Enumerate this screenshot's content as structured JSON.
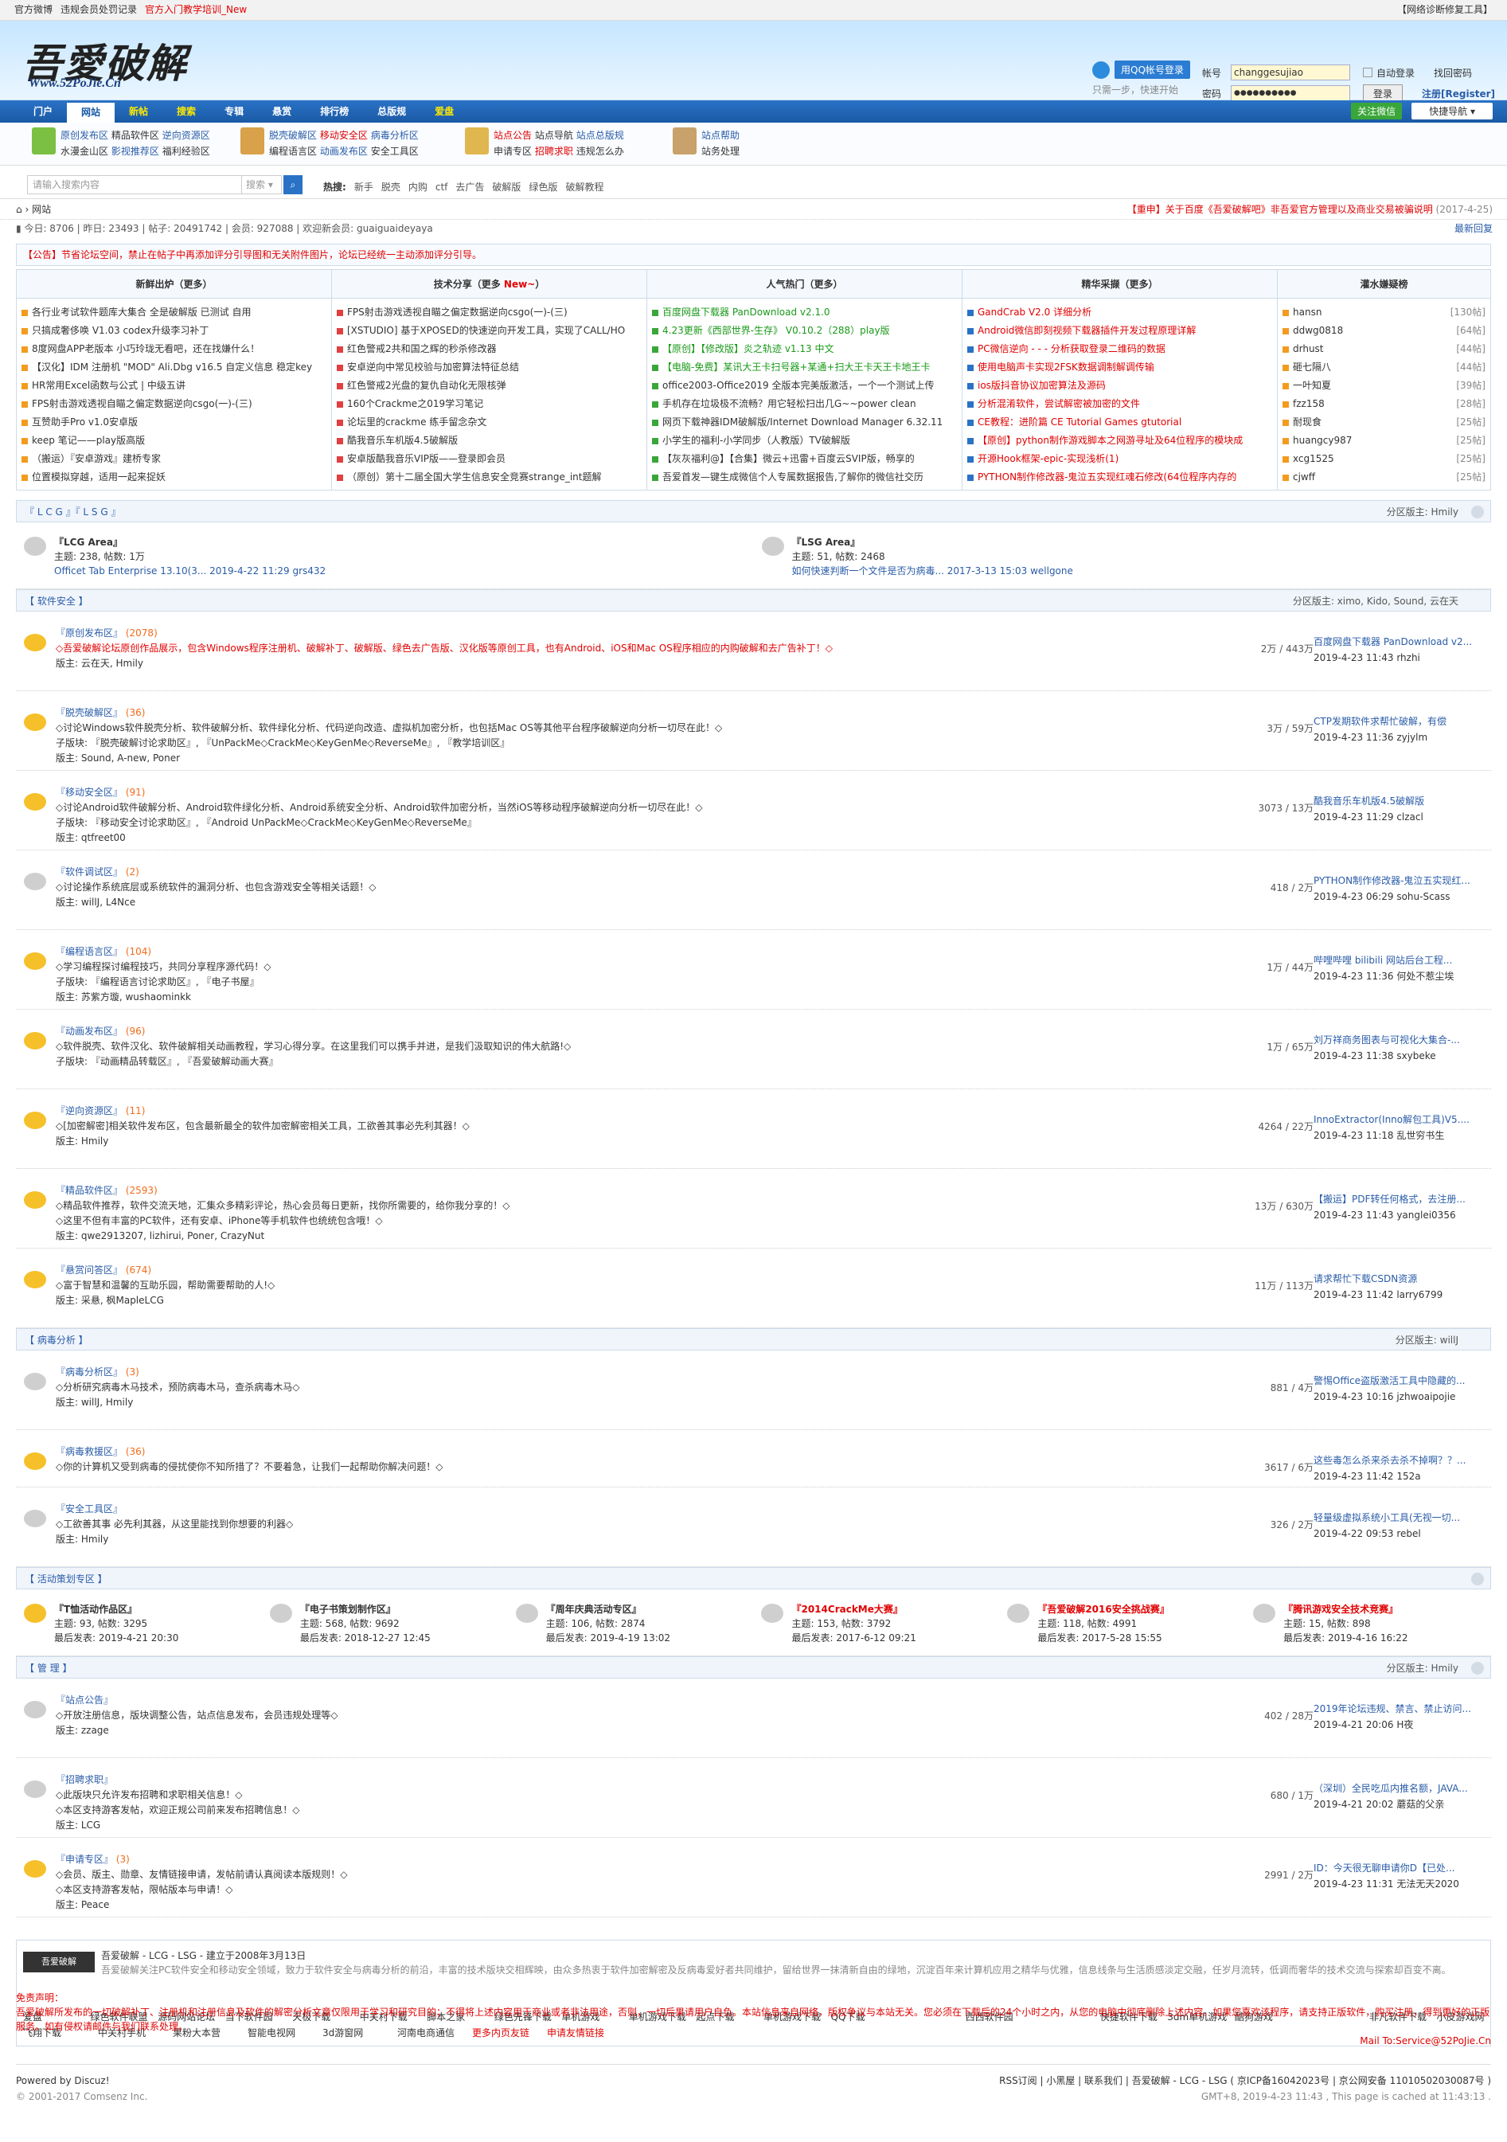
{
  "topbar": {
    "left": [
      "官方微博",
      "违规会员处罚记录",
      "官方入门教学培训_New"
    ],
    "right": "【网络诊断修复工具】"
  },
  "logo": {
    "cn": "吾愛破解",
    "en": "Www.52PoJie.Cn"
  },
  "qq": {
    "login": "用QQ帐号登录",
    "sub": "只需一步，快速开始"
  },
  "login": {
    "account_label": "帐号",
    "account_value": "changgesujiao",
    "auto": "自动登录",
    "find": "找回密码",
    "pwd_label": "密码",
    "pwd_value": "●●●●●●●●●●",
    "btn": "登录",
    "register": "注册[Register]"
  },
  "nav": {
    "items": [
      "门户",
      "网站",
      "新帖",
      "搜索",
      "专辑",
      "悬赏",
      "排行榜",
      "总版规",
      "爱盘"
    ],
    "active": 1,
    "wechat": "关注微信",
    "quick": "快捷导航"
  },
  "subnav": {
    "g1": [
      [
        "原创发布区",
        "精品软件区",
        "逆向资源区"
      ],
      [
        "水漫金山区",
        "影视推荐区",
        "福利经验区"
      ]
    ],
    "g2": [
      [
        "脱壳破解区",
        "移动安全区",
        "病毒分析区"
      ],
      [
        "编程语言区",
        "动画发布区",
        "安全工具区"
      ]
    ],
    "g3": [
      [
        "站点公告",
        "站点导航",
        "站点总版规"
      ],
      [
        "申请专区",
        "招聘求职",
        "违规怎么办"
      ]
    ],
    "g4": [
      [
        "站点帮助"
      ],
      [
        "站务处理"
      ]
    ]
  },
  "search": {
    "placeholder": "请输入搜索内容",
    "select": "搜索",
    "hot_label": "热搜:",
    "hot": [
      "新手",
      "脱壳",
      "内购",
      "ctf",
      "去广告",
      "破解版",
      "绿色版",
      "破解教程"
    ]
  },
  "crumb": {
    "home": "网站",
    "announce": "【重申】关于百度《吾爱破解吧》非吾爱官方管理以及商业交易被骗说明",
    "announce_date": "(2017-4-25)"
  },
  "stats": {
    "text": "今日: 8706 | 昨日: 23493 | 帖子: 20491742 | 会员: 927088 | 欢迎新会员: guaiguaideyaya",
    "latest": "最新回复"
  },
  "notice": "【公告】节省论坛空间，禁止在帖子中再添加评分引导图和无关附件图片，论坛已经统一主动添加评分引导。",
  "top5": [
    {
      "h": "新鲜出炉（更多）",
      "items": [
        "各行业考试软件题库大集合 全是破解版 已测试 自用",
        "只搞成奢侈唤 V1.03 codex升级李习补丁",
        "8度网盘APP老版本 小巧玲珑无看吧，还在找嫌什么！",
        "【汉化】IDM 注册机 \"MOD\" Ali.Dbg v16.5 自定义信息 稳定key",
        "HR常用Excel函数与公式 | 中级五讲",
        "FPS射击游戏透视自瞄之偏定数据逆向csgo(一)-(三)",
        "互赞助手Pro v1.0安卓版",
        "keep 笔记——play版高版",
        "（搬运）『安卓游戏』建桥专家",
        "位置模拟穿越，适用一起来捉妖"
      ]
    },
    {
      "h": "技术分享（更多 New~）",
      "items": [
        "FPS射击游戏透视自瞄之偏定数据逆向csgo(一)-(三)",
        "[XSTUDIO] 基于XPOSED的快速逆向开发工具，实现了CALL/HO",
        "红色警戒2共和国之辉的秒杀修改器",
        "安卓逆向中常见校验与加密算法特征总结",
        "红色警戒2光盘的复仇自动化无限核弹",
        "160个Crackme之019学习笔记",
        "论坛里的crackme 练手留念杂文",
        "酷我音乐车机版4.5破解版",
        "安卓版酷我音乐VIP版——登录即会员",
        "（原创）第十二届全国大学生信息安全竞赛strange_int题解"
      ]
    },
    {
      "h": "人气热门（更多）",
      "items": [
        "百度网盘下载器 PanDownload v2.1.0",
        "4.23更新《西部世界-生存》 V0.10.2（288）play版",
        "【原创】【修改版】炎之轨迹 v1.13 中文",
        "【电脑-免费】某讯大王卡扫号器+某通+扫大王卡天王卡地王卡",
        "office2003-Office2019 全版本完美版激活，一个一个测试上传",
        "手机存在垃圾极不流畅？用它轻松扫出几G~~power clean",
        "网页下载神器IDM破解版/Internet Download Manager 6.32.11",
        "小学生的福利-小学同步（人教版）TV破解版",
        "【灰灰福利@】【合集】微云+迅雷+百度云SVIP版，畅享的",
        "吾爱首发—键生成微信个人专属数据报告,了解你的微信社交历"
      ]
    },
    {
      "h": "精华采撷（更多）",
      "items": [
        "GandCrab V2.0 详细分析",
        "Android微信即刻视频下载器插件开发过程原理详解",
        "PC微信逆向 - - - 分析获取登录二维码的数据",
        "使用电脑声卡实现2FSK数据调制解调传输",
        "ios版抖音协议加密算法及源码",
        "分析混淆软件，尝试解密被加密的文件",
        "CE教程：进阶篇 CE Tutorial Games gtutorial",
        "【原创】python制作游戏脚本之网游寻址及64位程序的模块成",
        "开源Hook框架-epic-实现浅析(1)",
        "PYTHON制作修改器-鬼泣五实现红魂石修改(64位程序内存的"
      ]
    },
    {
      "h": "灌水嫌疑榜",
      "items": [
        [
          "hansn",
          "[130帖]"
        ],
        [
          "ddwg0818",
          "[64帖]"
        ],
        [
          "drhust",
          "[44帖]"
        ],
        [
          "砸七隔八",
          "[44帖]"
        ],
        [
          "一叶知夏",
          "[39帖]"
        ],
        [
          "fzz158",
          "[28帖]"
        ],
        [
          "耐现食",
          "[25帖]"
        ],
        [
          "huangcy987",
          "[25帖]"
        ],
        [
          "xcg1525",
          "[25帖]"
        ],
        [
          "cjwff",
          "[25帖]"
        ]
      ]
    }
  ],
  "lcg": {
    "h": "『 L C G 』『 L S G 』",
    "mod": "分区版主: Hmily",
    "items": [
      {
        "name": "『LCG Area』",
        "stat": "主题: 238, 帖数: 1万",
        "last": "Officet Tab Enterprise 13.10(3... 2019-4-22 11:29 grs432"
      },
      {
        "name": "『LSG Area』",
        "stat": "主题: 51, 帖数: 2468",
        "last": "如何快速判断一个文件是否为病毒... 2017-3-13 15:03 wellgone"
      }
    ]
  },
  "soft": {
    "h": "【 软件安全 】",
    "mod": "分区版主: ximo, Kido, Sound, 云在天",
    "forums": [
      {
        "name": "『原创发布区』",
        "n": "(2078)",
        "desc": "◇吾爱破解论坛原创作品展示，包含Windows程序注册机、破解补丁、破解版、绿色去广告版、汉化版等原创工具，也有Android、iOS和Mac OS程序相应的内购破解和去广告补丁！◇",
        "sub": "",
        "mods": "版主: 云在天, Hmily",
        "cnt": "2万 / 443万",
        "last1": "百度网盘下载器 PanDownload v2...",
        "last2": "2019-4-23 11:43 rhzhi",
        "hl": 1
      },
      {
        "name": "『脱壳破解区』",
        "n": "(36)",
        "desc": "◇讨论Windows软件脱壳分析、软件破解分析、软件绿化分析、代码逆向改造、虚拟机加密分析，也包括Mac OS等其他平台程序破解逆向分析一切尽在此！◇",
        "sub": "子版块: 『脱壳破解讨论求助区』, 『UnPackMe◇CrackMe◇KeyGenMe◇ReverseMe』, 『教学培训区』",
        "mods": "版主: Sound, A-new, Poner",
        "cnt": "3万 / 59万",
        "last1": "CTP发期软件求帮忙破解，有偿",
        "last2": "2019-4-23 11:36 zyjylm",
        "hl": 1
      },
      {
        "name": "『移动安全区』",
        "n": "(91)",
        "desc": "◇讨论Android软件破解分析、Android软件绿化分析、Android系统安全分析、Android软件加密分析，当然iOS等移动程序破解逆向分析一切尽在此！◇",
        "sub": "子版块: 『移动安全讨论求助区』, 『Android UnPackMe◇CrackMe◇KeyGenMe◇ReverseMe』",
        "mods": "版主: qtfreet00",
        "cnt": "3073 / 13万",
        "last1": "酷我音乐车机版4.5破解版",
        "last2": "2019-4-23 11:29 clzacl",
        "hl": 1
      },
      {
        "name": "『软件调试区』",
        "n": "(2)",
        "desc": "◇讨论操作系统底层或系统软件的漏洞分析、也包含游戏安全等相关话题！◇",
        "sub": "",
        "mods": "版主: willJ, L4Nce",
        "cnt": "418 / 2万",
        "last1": "PYTHON制作修改器-鬼泣五实现红...",
        "last2": "2019-4-23 06:29 sohu-Scass",
        "hl": 0
      },
      {
        "name": "『编程语言区』",
        "n": "(104)",
        "desc": "◇学习编程探讨编程技巧，共同分享程序源代码！◇",
        "sub": "子版块: 『编程语言讨论求助区』, 『电子书屋』",
        "mods": "版主: 苏紫方璇, wushaominkk",
        "cnt": "1万 / 44万",
        "last1": "哔哩哔哩 bilibili 网站后台工程...",
        "last2": "2019-4-23 11:36 何处不惹尘埃",
        "hl": 1
      },
      {
        "name": "『动画发布区』",
        "n": "(96)",
        "desc": "◇软件脱壳、软件汉化、软件破解相关动画教程，学习心得分享。在这里我们可以携手并进，是我们汲取知识的伟大航路!◇",
        "sub": "子版块: 『动画精品转载区』, 『吾爱破解动画大赛』",
        "mods": "",
        "cnt": "1万 / 65万",
        "last1": "刘万祥商务图表与可视化大集合-...",
        "last2": "2019-4-23 11:38 sxybeke",
        "hl": 1
      },
      {
        "name": "『逆向资源区』",
        "n": "(11)",
        "desc": "◇[加密解密]相关软件发布区，包含最新最全的软件加密解密相关工具，工欲善其事必先利其器！◇",
        "sub": "",
        "mods": "版主: Hmily",
        "cnt": "4264 / 22万",
        "last1": "InnoExtractor(Inno解包工具)V5....",
        "last2": "2019-4-23 11:18 乱世穷书生",
        "hl": 1
      },
      {
        "name": "『精品软件区』",
        "n": "(2593)",
        "desc": "◇精品软件推荐，软件交流天地，汇集众多精彩评论，热心会员每日更新，找你所需要的，给你我分享的！◇",
        "sub": "◇这里不但有丰富的PC软件，还有安卓、iPhone等手机软件也统统包含哦！◇",
        "mods": "版主: qwe2913207, lizhirui, Poner, CrazyNut",
        "cnt": "13万 / 630万",
        "last1": "【搬运】PDF转任何格式，去注册...",
        "last2": "2019-4-23 11:43 yanglei0356",
        "hl": 1
      },
      {
        "name": "『悬赏问答区』",
        "n": "(674)",
        "desc": "◇富于智慧和温馨的互助乐园，帮助需要帮助的人!◇",
        "sub": "",
        "mods": "版主: 采悬, 枫MapleLCG",
        "cnt": "11万 / 113万",
        "last1": "请求帮忙下载CSDN资源",
        "last2": "2019-4-23 11:42 larry6799",
        "hl": 1
      }
    ]
  },
  "virus": {
    "h": "【 病毒分析 】",
    "mod": "分区版主: willJ",
    "forums": [
      {
        "name": "『病毒分析区』",
        "n": "(3)",
        "desc": "◇分析研究病毒木马技术，预防病毒木马，查杀病毒木马◇",
        "sub": "",
        "mods": "版主: willJ, Hmily",
        "cnt": "881 / 4万",
        "last1": "警惕Office盗版激活工具中隐藏的...",
        "last2": "2019-4-23 10:16 jzhwoaipojie",
        "hl": 0
      },
      {
        "name": "『病毒救援区』",
        "n": "(36)",
        "desc": "◇你的计算机又受到病毒的侵扰使你不知所措了？不要着急，让我们一起帮助你解决问题！◇",
        "sub": "",
        "mods": "",
        "cnt": "3617 / 6万",
        "last1": "这些毒怎么杀来杀去杀不掉啊？？...",
        "last2": "2019-4-23 11:42 152a",
        "hl": 1
      },
      {
        "name": "『安全工具区』",
        "n": "",
        "desc": "◇工欲善其事 必先利其器，从这里能找到你想要的利器◇",
        "sub": "",
        "mods": "版主: Hmily",
        "cnt": "326 / 2万",
        "last1": "轻量级虚拟系统小工具(无视一切...",
        "last2": "2019-4-22 09:53 rebel",
        "hl": 0
      }
    ]
  },
  "activity": {
    "h": "【 活动策划专区 】",
    "items": [
      {
        "name": "『T恤活动作品区』",
        "stat": "主题: 93, 帖数: 3295",
        "last": "最后发表: 2019-4-21 20:30"
      },
      {
        "name": "『电子书策划制作区』",
        "stat": "主题: 568, 帖数: 9692",
        "last": "最后发表: 2018-12-27 12:45"
      },
      {
        "name": "『周年庆典活动专区』",
        "stat": "主题: 106, 帖数: 2874",
        "last": "最后发表: 2019-4-19 13:02"
      },
      {
        "name": "『2014CrackMe大赛』",
        "stat": "主题: 153, 帖数: 3792",
        "last": "最后发表: 2017-6-12 09:21"
      },
      {
        "name": "『吾爱破解2016安全挑战赛』",
        "stat": "主题: 118, 帖数: 4991",
        "last": "最后发表: 2017-5-28 15:55"
      },
      {
        "name": "『腾讯游戏安全技术竞赛』",
        "stat": "主题: 15, 帖数: 898",
        "last": "最后发表: 2019-4-16 16:22"
      }
    ]
  },
  "admin": {
    "h": "【 管 理 】",
    "mod": "分区版主: Hmily",
    "forums": [
      {
        "name": "『站点公告』",
        "n": "",
        "desc": "◇开放注册信息，版块调整公告，站点信息发布，会员违规处理等◇",
        "sub": "",
        "mods": "版主: zzage",
        "cnt": "402 / 28万",
        "last1": "2019年论坛违规、禁言、禁止访问...",
        "last2": "2019-4-21 20:06 H夜",
        "hl": 0
      },
      {
        "name": "『招聘求职』",
        "n": "",
        "desc": "◇此版块只允许发布招聘和求职相关信息！◇",
        "sub": "◇本区支持游客发帖，欢迎正规公司前来发布招聘信息！◇",
        "mods": "版主: LCG",
        "cnt": "680 / 1万",
        "last1": "（深圳）全民吃瓜内推名额，JAVA...",
        "last2": "2019-4-21 20:02 蘑菇的父亲",
        "hl": 0
      },
      {
        "name": "『申请专区』",
        "n": "(3)",
        "desc": "◇会员、版主、勋章、友情链接申请，发帖前请认真阅读本版规则！◇",
        "sub": "◇本区支持游客发帖，限帖版本与申请！◇",
        "mods": "版主: Peace",
        "cnt": "2991 / 2万",
        "last1": "ID：今天很无聊申请你D【已处...",
        "last2": "2019-4-23 11:31 无法无天2020",
        "hl": 1
      }
    ]
  },
  "footer": {
    "logo": "吾爱破解",
    "title": "吾爱破解 - LCG - LSG - 建立于2008年3月13日",
    "text": "吾爱破解关注PC软件安全和移动安全领域，致力于软件安全与病毒分析的前沿，丰富的技术版块交相辉映，由众多热衷于软件加密解密及反病毒爱好者共同维护，留给世界一抹清新自由的绿地，沉淀百年来计算机应用之精华与优雅，信息线条与生活质感淡定交融，任岁月流转，低调而奢华的技术交流与探索却百变不离。",
    "links1": [
      "爱盘",
      "绿色软件联盟",
      "源码网站论坛",
      "当下软件园",
      "天极下载",
      "中关村下载",
      "脚本之家",
      "绿色先锋下载",
      "单机游戏",
      "单机游戏下载",
      "起点下载",
      "单机游戏下载",
      "QQ下载",
      "",
      "西西软件园",
      "",
      "快捷软件下载",
      "3dm单机游戏",
      "酷狗游戏",
      "",
      "非凡软件下载",
      "小皮游戏网"
    ],
    "links2": [
      "飞翔下载",
      "中关村手机",
      "果粉大本营",
      "智能电视网",
      "3d游窗网",
      "河南电商通信",
      "更多内页友链",
      "申请友情链接"
    ]
  },
  "disclaimer": {
    "title": "免责声明：",
    "text": "吾爱破解所发布的一切破解补丁、注册机和注册信息及软件的解密分析文章仅限用于学习和研究目的；不得将上述内容用于商业或者非法用途，否则，一切后果请用户自负。本站信息来自网络，版权争议与本站无关。您必须在下载后的24个小时之内，从您的电脑中彻底删除上述内容。如果您喜欢该程序，请支持正版软件，购买注册，得到更好的正版服务。如有侵权请邮件与我们联系处理。",
    "mail": "Mail To:Service@52PoJie.Cn"
  },
  "bottom": {
    "powered": "Powered by Discuz!",
    "copy": "© 2001-2017 Comsenz Inc.",
    "right1": "RSS订阅 | 小黑屋 | 联系我们 | 吾爱破解 - LCG - LSG ( 京ICP备16042023号 | 京公网安备 11010502030087号 )",
    "right2": "GMT+8, 2019-4-23 11:43 , This page is cached at 11:43:13 ."
  }
}
